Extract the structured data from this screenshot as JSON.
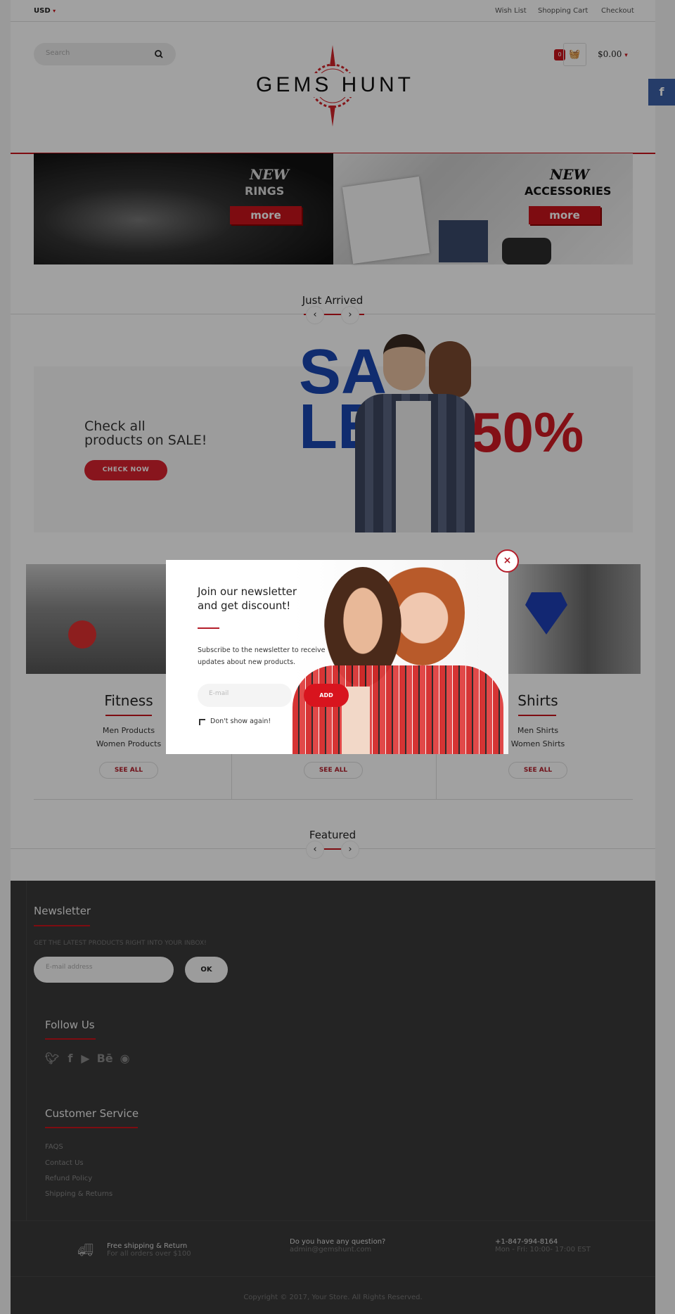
{
  "topbar": {
    "currency": "USD",
    "links": [
      "Wish List",
      "Shopping Cart",
      "Checkout"
    ]
  },
  "header": {
    "search_placeholder": "Search",
    "logo_text": "GEMS HUNT",
    "cart_count": "0",
    "cart_total": "$0.00"
  },
  "social_tab": {
    "icon": "facebook-icon",
    "label": "f"
  },
  "banners": [
    {
      "new": "NEW",
      "title": "RINGS",
      "button": "more"
    },
    {
      "new": "NEW",
      "title": "ACCESSORIES",
      "button": "more"
    }
  ],
  "just_arrived": {
    "title": "Just Arrived"
  },
  "sale": {
    "line1": "Check all",
    "line2": "products on SALE!",
    "button": "CHECK NOW",
    "big_word_1": "SA",
    "big_word_2": "LE",
    "percent": "50%"
  },
  "categories": [
    {
      "title": "Fitness",
      "links": [
        "Men Products",
        "Women Products"
      ],
      "button": "SEE ALL"
    },
    {
      "title": "",
      "links": [],
      "button": "SEE ALL"
    },
    {
      "title": "Shirts",
      "links": [
        "Men Shirts",
        "Women Shirts"
      ],
      "button": "SEE ALL"
    }
  ],
  "featured": {
    "title": "Featured"
  },
  "footer": {
    "newsletter": {
      "title": "Newsletter",
      "caption": "GET THE LATEST PRODUCTS RIGHT INTO YOUR INBOX!",
      "placeholder": "E-mail address",
      "button": "OK"
    },
    "follow": {
      "title": "Follow Us",
      "icons": [
        "twitter-icon",
        "facebook-icon",
        "youtube-icon",
        "behance-icon",
        "github-icon"
      ]
    },
    "service": {
      "title": "Customer Service",
      "links": [
        "FAQS",
        "Contact Us",
        "Refund Policy",
        "Shipping & Returns"
      ]
    },
    "info": [
      {
        "title": "Free shipping & Return",
        "sub": "For all orders over $100"
      },
      {
        "title": "Do you have any question?",
        "sub": "admin@gemshunt.com"
      },
      {
        "title": "+1-847-994-8164",
        "sub": "Mon - Fri: 10:00- 17:00 EST"
      }
    ],
    "copyright": "Copyright © 2017, Your Store. All Rights Reserved."
  },
  "modal": {
    "title_1": "Join our newsletter",
    "title_2": "and get discount!",
    "text_1": "Subscribe to the newsletter to receive",
    "text_2": "updates about new products.",
    "email_placeholder": "E-mail",
    "add_button": "ADD",
    "dont_show": "Don't show again!",
    "close": "×"
  },
  "colors": {
    "accent": "#c8141c",
    "sale_blue": "#1a47b0",
    "footer_bg": "#393939"
  }
}
